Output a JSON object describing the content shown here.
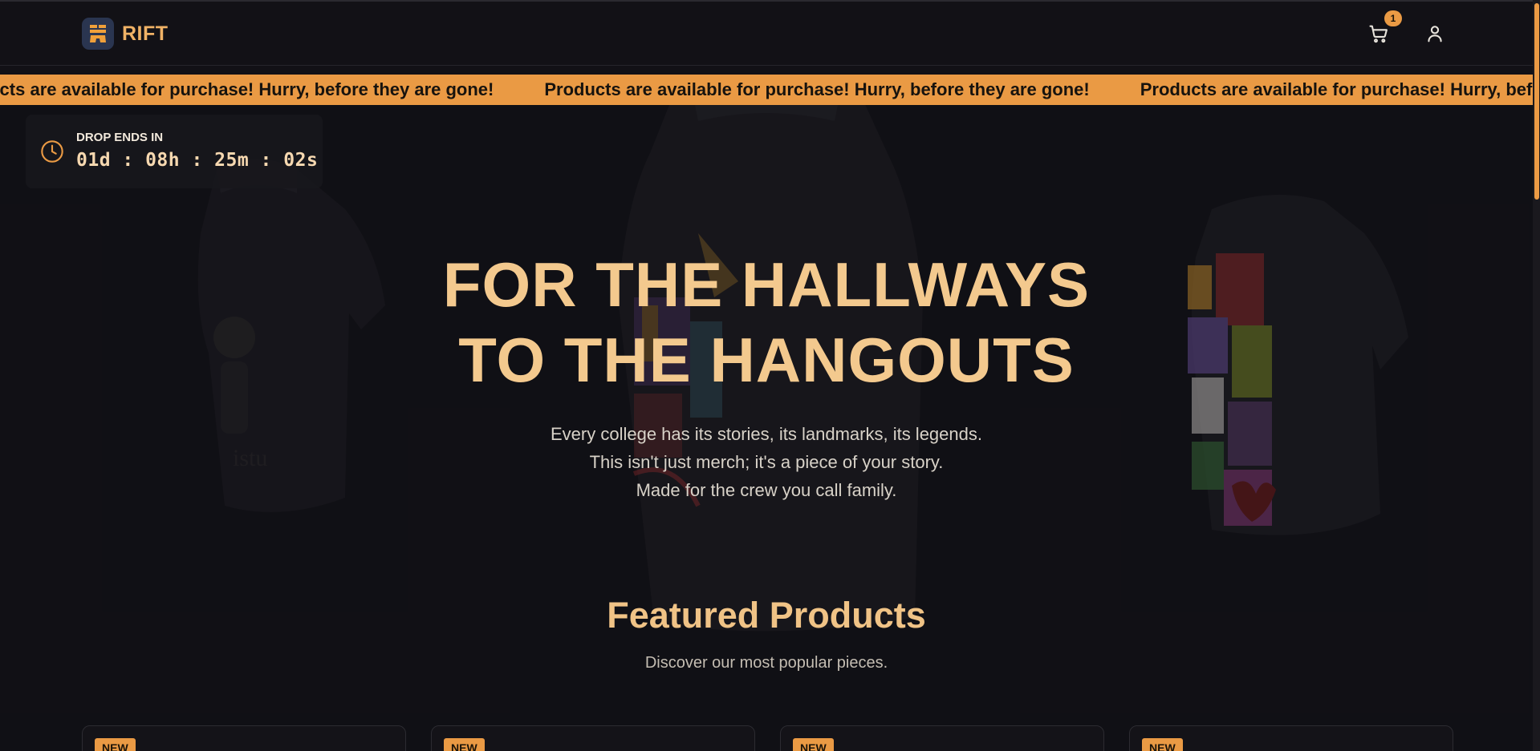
{
  "brand": {
    "name": "RIFT",
    "accent_color": "#ea9a44",
    "logo_icon": "rift-logo-icon"
  },
  "header": {
    "cart_icon": "cart-icon",
    "cart_count": "1",
    "user_icon": "user-icon"
  },
  "banner": {
    "items": [
      "Products are available for purchase! Hurry, before they are gone!",
      "Products are available for purchase! Hurry, before they are gone!",
      "Products are available for purchase! Hurry, before they are gone!"
    ]
  },
  "timer": {
    "icon": "clock-icon",
    "label": "DROP ENDS IN",
    "value": "01d : 08h : 25m : 02s"
  },
  "hero": {
    "title_line1": "FOR THE HALLWAYS",
    "title_line2": "TO THE HANGOUTS",
    "subtitle_lines": [
      "Every college has its stories, its landmarks, its legends.",
      "This isn't just merch; it's a piece of your story.",
      "Made for the crew you call family."
    ]
  },
  "featured": {
    "title": "Featured Products",
    "subtitle": "Discover our most popular pieces.",
    "cards": [
      {
        "badge": "NEW"
      },
      {
        "badge": "NEW"
      },
      {
        "badge": "NEW"
      },
      {
        "badge": "NEW"
      }
    ]
  }
}
